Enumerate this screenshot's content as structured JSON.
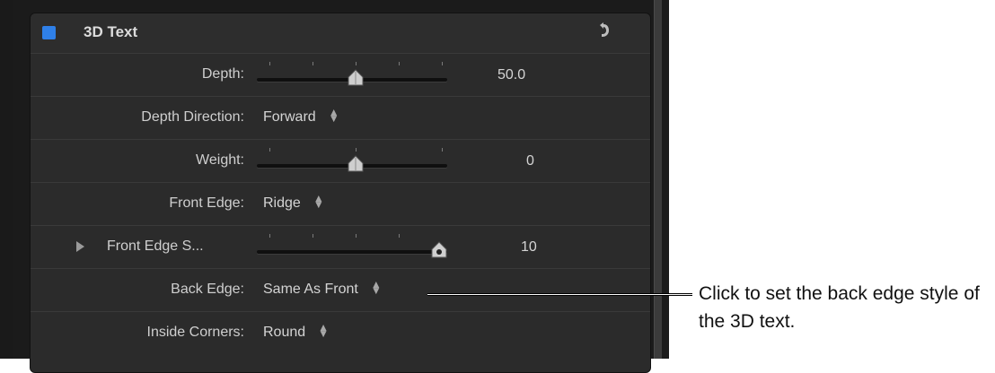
{
  "panel": {
    "title": "3D Text",
    "enabled": true,
    "accent_color": "#2f80e8",
    "reset_icon": "reset-arrow-icon"
  },
  "rows": {
    "depth": {
      "label": "Depth:",
      "value": "50.0",
      "level": 0.5
    },
    "depth_direction": {
      "label": "Depth Direction:",
      "value": "Forward"
    },
    "weight": {
      "label": "Weight:",
      "value": "0",
      "level": 0.5
    },
    "front_edge": {
      "label": "Front Edge:",
      "value": "Ridge"
    },
    "front_edge_size": {
      "label": "Front Edge S...",
      "value": "10",
      "level": 0.95
    },
    "back_edge": {
      "label": "Back Edge:",
      "value": "Same As Front"
    },
    "inside_corners": {
      "label": "Inside Corners:",
      "value": "Round"
    }
  },
  "callout": {
    "text": "Click to set the back edge style of the 3D text."
  }
}
